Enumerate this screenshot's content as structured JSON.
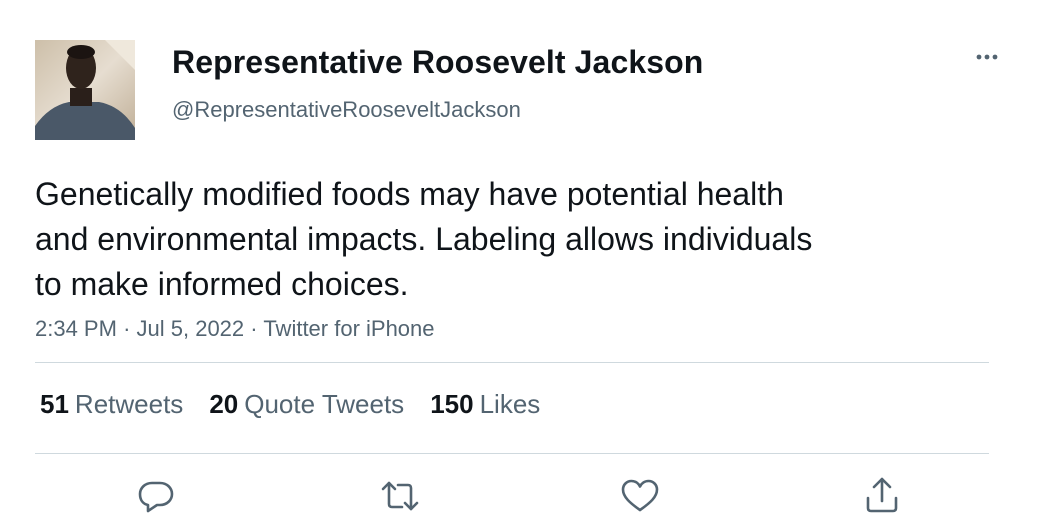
{
  "author": {
    "display_name": "Representative Roosevelt Jackson",
    "handle": "@RepresentativeRooseveltJackson",
    "avatar_icon": "profile-photo"
  },
  "tweet": {
    "text": "Genetically modified foods may have potential health\nand environmental impacts. Labeling allows individuals\nto make informed choices.",
    "time": "2:34 PM",
    "separator": "·",
    "date": "Jul 5, 2022",
    "source": "Twitter for iPhone"
  },
  "stats": {
    "retweets_count": "51",
    "retweets_label": "Retweets",
    "quotes_count": "20",
    "quotes_label": "Quote Tweets",
    "likes_count": "150",
    "likes_label": "Likes"
  },
  "actions": {
    "reply_icon": "reply-icon",
    "retweet_icon": "retweet-icon",
    "like_icon": "heart-icon",
    "share_icon": "share-icon"
  },
  "colors": {
    "text_primary": "#0f1419",
    "text_secondary": "#536471",
    "divider": "#cfd9de"
  }
}
